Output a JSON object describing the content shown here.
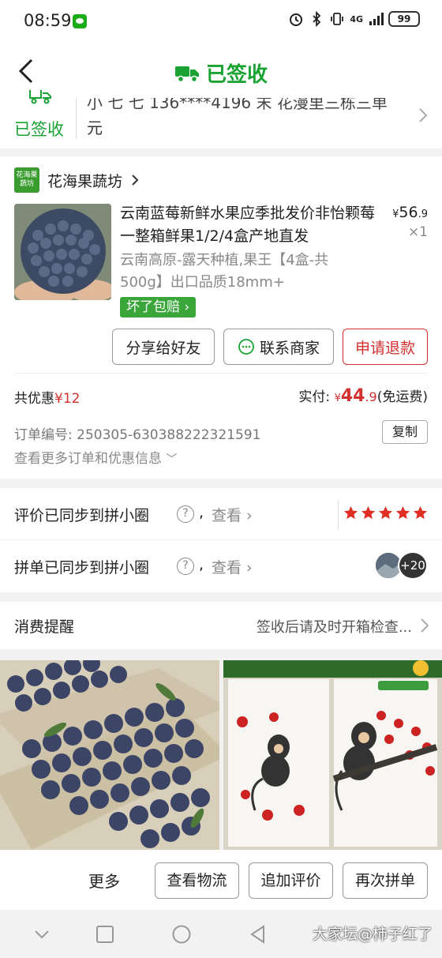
{
  "status_bar": {
    "time": "08:59",
    "network": "4G",
    "battery": "99"
  },
  "header": {
    "title": "已签收"
  },
  "address": {
    "status_label": "已签收",
    "line1": "小 七 七  136****4196 末  花漫里三栋三单",
    "line2": "元"
  },
  "order": {
    "shop": {
      "logo_text": "花海果蔬坊",
      "name": "花海果蔬坊"
    },
    "product": {
      "title": "云南蓝莓新鲜水果应季批发价非怡颗莓一整箱鲜果1/2/4盒产地直发",
      "price_currency": "¥",
      "price_int": "56",
      "price_dec": ".9",
      "qty": "×1",
      "spec": "云南高原-露天种植,果王【4盒-共500g】出口品质18mm+",
      "guarantee_badge": "坏了包赔",
      "image": "blueberries-bowl"
    },
    "buttons": {
      "share": "分享给好友",
      "contact": "联系商家",
      "refund": "申请退款"
    },
    "discount_label": "共优惠",
    "discount_amount": "¥12",
    "paid_label": "实付:",
    "paid_currency": "¥",
    "paid_int": "44",
    "paid_dec": ".9",
    "paid_note": "(免运费)",
    "order_no": "订单编号:  250305-630388222321591",
    "copy": "复制",
    "more_info": "查看更多订单和优惠信息"
  },
  "sync": {
    "review_label": "评价已同步到拼小圈",
    "group_label": "拼单已同步到拼小圈",
    "sep": ",",
    "view": "查看",
    "rating": 5,
    "avatar_count": "+20"
  },
  "reminder": {
    "title": "消费提醒",
    "text": "签收后请及时开箱检查..."
  },
  "images": {
    "left": "blueberries-in-boxes",
    "right": "monkey-painting-book"
  },
  "action_bar": {
    "more": "更多",
    "logistics": "查看物流",
    "add_review": "追加评价",
    "reorder": "再次拼单"
  },
  "watermark": "大家坛@柿子红了",
  "colors": {
    "green": "#1aa333",
    "red": "#d43030"
  }
}
